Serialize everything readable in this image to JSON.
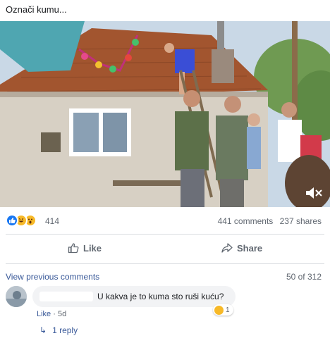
{
  "post": {
    "caption": "Označi kumu..."
  },
  "photo": {
    "description": "video-still",
    "muted_icon": "speaker-muted-icon"
  },
  "stats": {
    "reaction_icons": [
      "like-reaction-icon",
      "haha-reaction-icon",
      "wow-reaction-icon"
    ],
    "reactions": "414",
    "comments": "441 comments",
    "shares": "237 shares"
  },
  "actions": {
    "like": "Like",
    "share": "Share"
  },
  "comments": {
    "view_previous": "View previous comments",
    "pager": "50 of 312",
    "item": {
      "text": "U kakva je to kuma sto ruši kuću?",
      "reaction_count": "1",
      "like": "Like",
      "time": "5d"
    },
    "reply": "1 reply"
  },
  "colors": {
    "facebook_blue": "#1877f2",
    "link": "#385898",
    "muted": "#606770"
  }
}
